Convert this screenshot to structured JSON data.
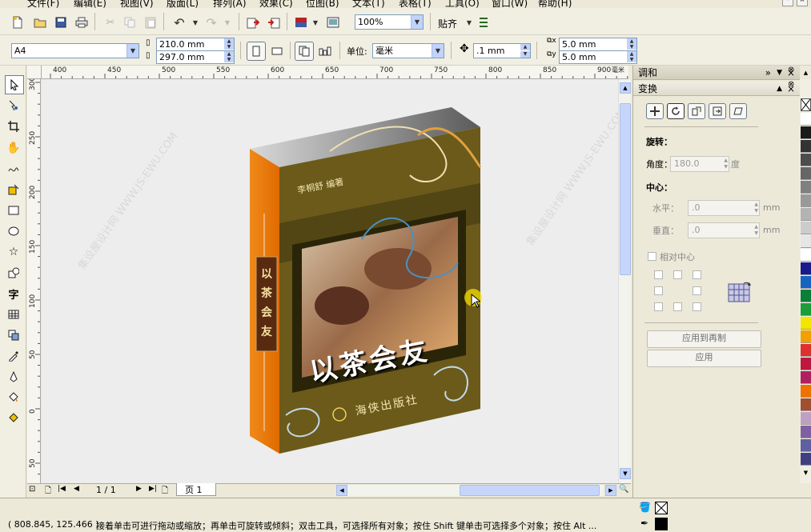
{
  "menu": [
    "文件(F)",
    "编辑(E)",
    "视图(V)",
    "版面(L)",
    "排列(A)",
    "效果(C)",
    "位图(B)",
    "文本(T)",
    "表格(T)",
    "工具(O)",
    "窗口(W)",
    "帮助(H)"
  ],
  "toolbar": {
    "zoom": "100%",
    "snap_label": "贴齐"
  },
  "property_bar": {
    "paper_size": "A4",
    "width": "210.0 mm",
    "height": "297.0 mm",
    "units_label": "单位:",
    "units_value": "毫米",
    "nudge": ".1 mm",
    "dup_x": "5.0 mm",
    "dup_y": "5.0 mm"
  },
  "ruler": {
    "h_ticks": [
      "400",
      "450",
      "500",
      "550",
      "600",
      "650",
      "700",
      "750",
      "800",
      "850",
      "900"
    ],
    "h_unit": "毫米",
    "v_ticks": [
      "300",
      "250",
      "200",
      "150",
      "100",
      "50",
      "0",
      "50"
    ]
  },
  "artwork": {
    "author": "李桐舒  编著",
    "title": "以茶会友",
    "spine_title": "以茶会友",
    "publisher": "海侠出版社",
    "watermark": "集设屋设计网 WWW.JS-EWU.COM"
  },
  "page_nav": {
    "counter": "1 / 1",
    "tab": "页 1"
  },
  "docker": {
    "outer_title": "调和",
    "panel_title": "变换",
    "rotate_label": "旋转：",
    "angle_label": "角度：",
    "angle_value": "180.0",
    "angle_unit": "度",
    "center_label": "中心：",
    "h_label": "水平：",
    "h_value": ".0",
    "h_unit": "mm",
    "v_label": "垂直：",
    "v_value": ".0",
    "v_unit": "mm",
    "relative_center": "相对中心",
    "apply_dup": "应用到再制",
    "apply": "应用"
  },
  "palette": [
    "#ffffff",
    "#1a1a1a",
    "#333333",
    "#4d4d4d",
    "#666666",
    "#808080",
    "#999999",
    "#b3b3b3",
    "#cccccc",
    "#e6e6e6",
    "#ffffff",
    "#1a1a8c",
    "#1565c0",
    "#0a7f3a",
    "#1c9d3c",
    "#f2e600",
    "#f0a000",
    "#e0302e",
    "#c0183c",
    "#b02060",
    "#f07000",
    "#a05030",
    "#c0a0c0",
    "#8060a0",
    "#6060a0",
    "#404080"
  ],
  "status": {
    "coords": "( 808.845, 125.466 )",
    "hint": "接着单击可进行拖动或缩放；再单击可旋转或倾斜；双击工具，可选择所有对象；按住 Shift 键单击可选择多个对象；按住 Alt ..."
  }
}
